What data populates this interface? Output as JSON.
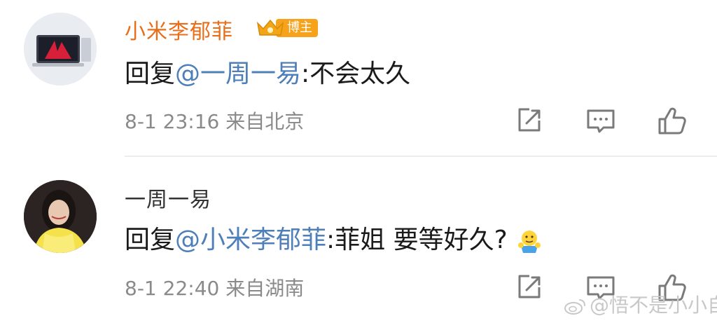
{
  "comments": [
    {
      "username": "小米李郁菲",
      "badge_label": "博主",
      "reply_prefix": "回复",
      "mention": "@一周一易",
      "reply_text": ":不会太久",
      "time": "8-1 23:16",
      "location": "来自北京"
    },
    {
      "username": "一周一易",
      "reply_prefix": "回复",
      "mention": "@小米李郁菲",
      "reply_text": ":菲姐 要等好久?",
      "time": "8-1 22:40",
      "location": "来自湖南"
    }
  ],
  "watermark": "@悟不是小小自",
  "colors": {
    "vip_name": "#e86e1a",
    "mention": "#4e7fb8",
    "meta": "#8a8a8a",
    "badge": "#f7a21b"
  }
}
